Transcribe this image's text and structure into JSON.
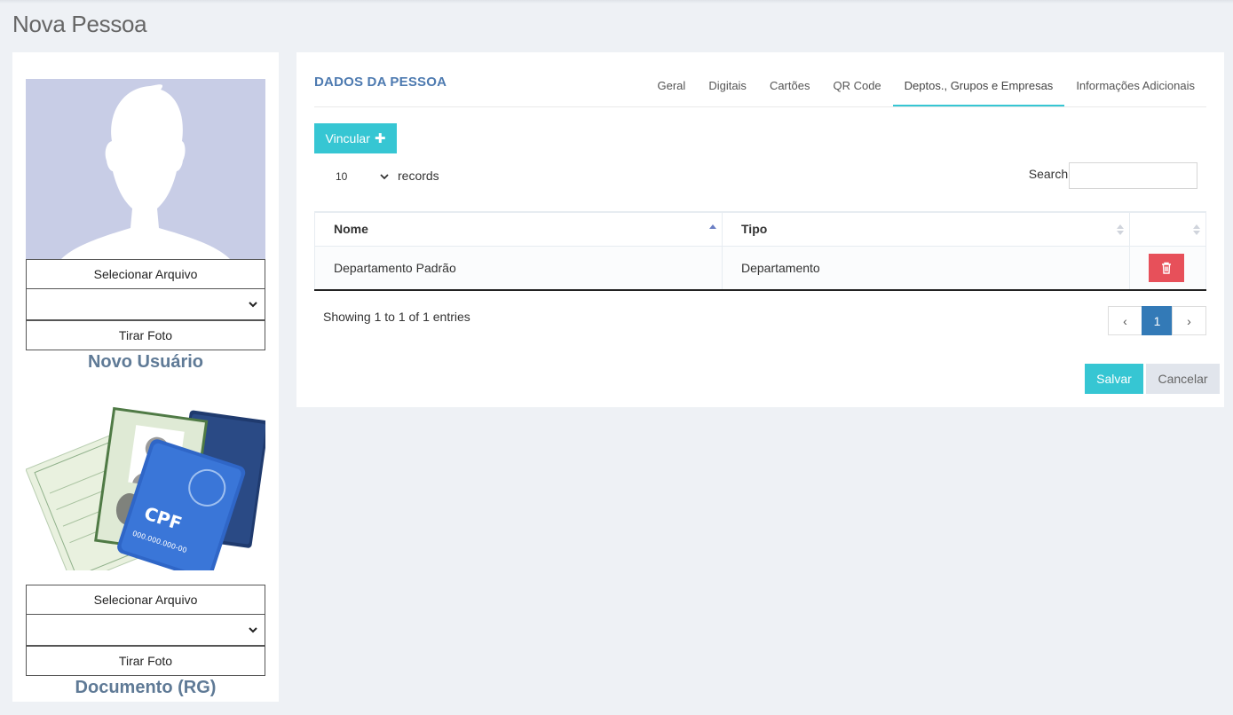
{
  "page": {
    "title": "Nova Pessoa"
  },
  "left": {
    "photo": {
      "select_file_label": "Selecionar Arquivo",
      "select_value": "",
      "take_photo_label": "Tirar Foto",
      "caption": "Novo Usuário"
    },
    "document": {
      "select_file_label": "Selecionar Arquivo",
      "select_value": "",
      "take_photo_label": "Tirar Foto",
      "caption": "Documento (RG)",
      "card_text": "CPF",
      "card_number": "000.000.000-00"
    }
  },
  "main": {
    "section_title": "DADOS DA PESSOA",
    "tabs": [
      {
        "label": "Geral",
        "active": false
      },
      {
        "label": "Digitais",
        "active": false
      },
      {
        "label": "Cartões",
        "active": false
      },
      {
        "label": "QR Code",
        "active": false
      },
      {
        "label": "Deptos., Grupos e Empresas",
        "active": true
      },
      {
        "label": "Informações Adicionais",
        "active": false
      }
    ],
    "vincular_label": "Vincular",
    "records_value": "10",
    "records_label": "records",
    "search_label": "Search:",
    "search_value": "",
    "table": {
      "headers": [
        "Nome",
        "Tipo",
        ""
      ],
      "rows": [
        {
          "nome": "Departamento Padrão",
          "tipo": "Departamento"
        }
      ]
    },
    "showing_text": "Showing 1 to 1 of 1 entries",
    "pagination": {
      "prev": "‹",
      "current": "1",
      "next": "›"
    },
    "save_label": "Salvar",
    "cancel_label": "Cancelar"
  },
  "colors": {
    "accent": "#36c6d3",
    "danger": "#e7505a",
    "primary": "#337ab7",
    "title_blue": "#4d7ab0"
  }
}
